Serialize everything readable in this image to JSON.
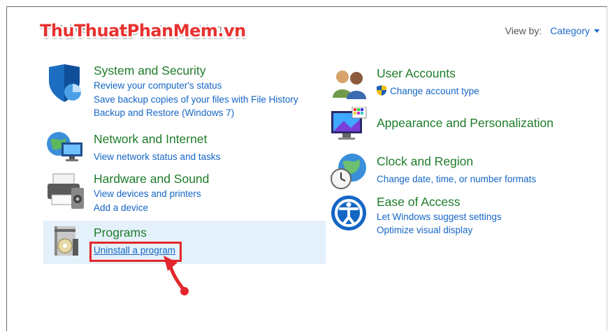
{
  "header": {
    "heading": "Adjust your computer's settings",
    "watermark": "ThuThuatPhanMem.vn",
    "view_by_label": "View by:",
    "view_by_value": "Category"
  },
  "left_categories": [
    {
      "title": "System and Security",
      "icon": "shield-icon",
      "links": [
        "Review your computer's status",
        "Save backup copies of your files with File History",
        "Backup and Restore (Windows 7)"
      ]
    },
    {
      "title": "Network and Internet",
      "icon": "network-icon",
      "links": [
        "View network status and tasks"
      ]
    },
    {
      "title": "Hardware and Sound",
      "icon": "printer-icon",
      "links": [
        "View devices and printers",
        "Add a device"
      ]
    },
    {
      "title": "Programs",
      "icon": "programs-icon",
      "links": [
        "Uninstall a program"
      ]
    }
  ],
  "right_categories": [
    {
      "title": "User Accounts",
      "icon": "users-icon",
      "links": [
        "Change account type"
      ]
    },
    {
      "title": "Appearance and Personalization",
      "icon": "monitor-icon",
      "links": []
    },
    {
      "title": "Clock and Region",
      "icon": "clock-globe-icon",
      "links": [
        "Change date, time, or number formats"
      ]
    },
    {
      "title": "Ease of Access",
      "icon": "ease-of-access-icon",
      "links": [
        "Let Windows suggest settings",
        "Optimize visual display"
      ]
    }
  ],
  "colors": {
    "title": "#1e7c2a",
    "link": "#1566c6",
    "highlight": "#e4f1fb",
    "annotation": "#e3262b"
  }
}
